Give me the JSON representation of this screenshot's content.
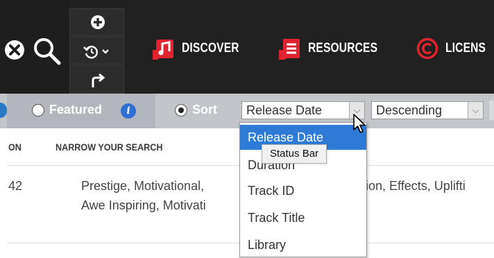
{
  "toolbar": {
    "nav": [
      {
        "label": "DISCOVER",
        "icon": "music-note-icon"
      },
      {
        "label": "RESOURCES",
        "icon": "document-list-icon"
      },
      {
        "label": "LICENS",
        "icon": "copyright-icon"
      }
    ],
    "brand_color": "#e0242f"
  },
  "filters": {
    "featured_label": "Featured",
    "info_label": "i",
    "sort_label": "Sort",
    "sort_by_value": "Release Date",
    "sort_order_value": "Descending"
  },
  "table": {
    "headers": [
      "ON",
      "NARROW YOUR SEARCH"
    ],
    "row1": {
      "num": "42",
      "tags_line1": "Prestige, Motivational,",
      "tags_line1_right": "ion, Effects, Uplifti",
      "tags_line2": "Awe Inspiring, Motivati"
    }
  },
  "dropdown": {
    "options": [
      "Release Date",
      "Duration",
      "Track ID",
      "Track Title",
      "Library"
    ],
    "selected": "Release Date"
  },
  "tooltip": "Status Bar"
}
